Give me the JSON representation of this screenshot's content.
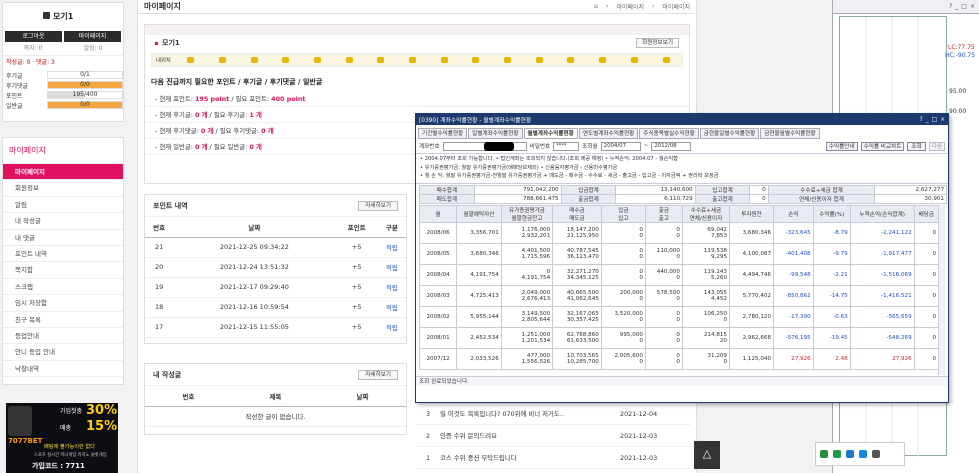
{
  "side": {
    "username": "모기1",
    "login_btn": "로그아웃",
    "mypage_btn": "마이페이지",
    "note_label": "쪽지: 0",
    "alarm_label": "알림: 0",
    "activity": "작성글: 0 · 댓글: 3",
    "stats": [
      {
        "k": "후기글",
        "v": "0/1",
        "fill": 0
      },
      {
        "k": "후기댓글",
        "v": "0/0",
        "fill": 1,
        "orange": true
      },
      {
        "k": "포인트",
        "v": "195/400",
        "fill": 0.49
      },
      {
        "k": "일반글",
        "v": "0/0",
        "fill": 1,
        "orange": true
      }
    ],
    "menu_title": "마이페이지",
    "menu": [
      "마이페이지",
      "회원정보",
      "알림",
      "내 작성글",
      "내 댓글",
      "포인트 내역",
      "쪽지함",
      "스크랩",
      "임시 저장함",
      "친구 목록",
      "등업안내",
      "안니 등업 안내",
      "낙찰내역"
    ],
    "ad_line1": "가입첫충",
    "ad_pct1": "30%",
    "ad_brand": "7077BET",
    "ad_line2": "매충",
    "ad_pct2": "15%",
    "ad_line3": "배팅에 불가능이란 없다",
    "ad_line4": "스포츠 실시간 미니게임 카지노 슬롯게임",
    "ad_code": "가입코드 : 7711"
  },
  "main": {
    "title": "마이페이지",
    "breadcrumb": [
      "마이페이지",
      "마이페이지"
    ],
    "user": "모기1",
    "info_btn": "회원정보보기",
    "level_label": "내위치",
    "next_title": "다음 진급까지 필요한 포인트 / 후기글 / 후기댓글 / 일반글",
    "req_lines": [
      {
        "a": "- 현재 포인트: ",
        "av": "195 point",
        "b": " / 필요 포인트: ",
        "bv": "400 point"
      },
      {
        "a": "- 현재 후기글: ",
        "av": "0 개",
        "b": " / 필요 후기글: ",
        "bv": "1 개"
      },
      {
        "a": "- 현재 후기댓글: ",
        "av": "0 개",
        "b": " / 필요 후기댓글: ",
        "bv": "0 개"
      },
      {
        "a": "- 현재 일반글: ",
        "av": "0 개",
        "b": " / 필요 일반글: ",
        "bv": "0 개"
      }
    ],
    "points_title": "포인트 내역",
    "more": "자세히보기",
    "points_headers": [
      "번호",
      "날짜",
      "포인트",
      "구분"
    ],
    "points": [
      {
        "n": "21",
        "d": "2021-12-25 09:34:22",
        "p": "+5",
        "t": "적립"
      },
      {
        "n": "20",
        "d": "2021-12-24 13:51:32",
        "p": "+5",
        "t": "적립"
      },
      {
        "n": "19",
        "d": "2021-12-17 09:29:40",
        "p": "+5",
        "t": "적립"
      },
      {
        "n": "18",
        "d": "2021-12-16 10:59:54",
        "p": "+5",
        "t": "적립"
      },
      {
        "n": "17",
        "d": "2021-12-15 11:55:05",
        "p": "+5",
        "t": "적립"
      }
    ],
    "posts_title": "내 작성글",
    "posts_headers": [
      "번호",
      "제목",
      "날짜"
    ],
    "posts_empty": "작성한 글이 없습니다.",
    "comments": [
      {
        "n": "3",
        "t": "릴 이것도 목록입니다? 070위에 비너 저거도..",
        "d": "2021-12-04"
      },
      {
        "n": "2",
        "t": "인증 수위 문의드려요",
        "d": "2021-12-03"
      },
      {
        "n": "1",
        "t": "코스 수위 중션 부탁드립니다",
        "d": "2021-12-03"
      }
    ]
  },
  "win": {
    "title": "[0390] 계좌수익률현황 - 월별계좌수익률현황",
    "tabs": [
      "기간별수익률현황",
      "일별계좌수익률현황",
      "월별계좌수익률현황",
      "연도별계좌수익률현황",
      "주식종목별실수익현황",
      "금현물일별수익률현황",
      "금현물월별수익률현황"
    ],
    "acct_label": "계좌번호",
    "pw_label": "비밀번호",
    "pw": "****",
    "period_label": "조회월",
    "from": "2004/07",
    "to": "2012/08",
    "b1": "수익률안내",
    "b2": "수익률 비교차트",
    "b3": "조회",
    "b4": "다음",
    "notes": [
      "• 2004.07부터 조회 가능합니다.   • 법인계좌는 조회되지 않습니다.(조회 제공 예정)   • 누적손익: 2004.07 - 월손익합",
      "• 유가증권평가금: 월말 유가증권평가금(매매당보제외) • 신용융자평가금 - 신용미수평가금",
      "• 월 손 익: 월말 유가증권평가금-전월말 유가증권평가금 + 매도금 - 매수금 - 수수료 - 세금 - 출고금 - 입고금 - 이자금액 + 권리락 보정금"
    ],
    "sum": [
      [
        "매수합계",
        "791,042,200",
        "입금합계",
        "13,140,600",
        "입고합계",
        "0",
        "수수료+세금 합계",
        "2,627,277"
      ],
      [
        "매도합계",
        "788,661,475",
        "출금합계",
        "6,110,729",
        "출고합계",
        "0",
        "연체/신용이자 합계",
        "30,901"
      ]
    ],
    "headers": [
      "월",
      "월말예탁자산",
      "유가증권평가금|월말현금잔고",
      "매수금|매도금",
      "입금|입고",
      "출금|출고",
      "수수료+세금|연체/신용이자",
      "투자원잔",
      "손익",
      "수익률(%)",
      "누적손익(손익합계)",
      "배당금"
    ],
    "rows": [
      [
        "2008/06",
        "3,356,701",
        "1,176,000|2,932,201",
        "18,147,200|21,125,950",
        "0|0",
        "0|0",
        "69,042|7,853",
        "3,680,346",
        "-323,645",
        "-8.79",
        "-2,241,122",
        "0"
      ],
      [
        "2008/05",
        "3,680,346",
        "4,401,500|1,715,596",
        "40,787,545|36,113,470",
        "0|0",
        "110,000|0",
        "119,538|9,295",
        "4,100,087",
        "-401,408",
        "-9.79",
        "-1,917,477",
        "0"
      ],
      [
        "2008/04",
        "4,191,754",
        "0|4,191,754",
        "32,271,270|34,345,125",
        "0|0",
        "440,000|0",
        "119,143|5,260",
        "4,494,746",
        "-99,548",
        "-2.21",
        "-1,516,069",
        "0"
      ],
      [
        "2008/03",
        "4,725,413",
        "2,049,000|2,676,413",
        "40,665,500|41,062,645",
        "200,000|0",
        "578,500|0",
        "143,055|4,452",
        "5,770,402",
        "-850,862",
        "-14.75",
        "-1,416,521",
        "0"
      ],
      [
        "2008/02",
        "5,955,144",
        "3,149,500|2,805,644",
        "32,167,065|30,357,425",
        "3,520,000|0",
        "0|0",
        "106,250|0",
        "2,780,120",
        "-17,390",
        "-0.63",
        "-565,659",
        "0"
      ],
      [
        "2008/01",
        "2,452,534",
        "1,251,000|1,201,534",
        "62,768,860|61,633,500",
        "995,000|0",
        "0|0",
        "214,815|20",
        "2,962,668",
        "-576,195",
        "-19.45",
        "-548,269",
        "0"
      ],
      [
        "2007/12",
        "2,033,526",
        "477,000|1,556,526",
        "10,703,565|10,285,700",
        "2,005,600|0",
        "0|0",
        "31,209|0",
        "1,125,040",
        "27,926",
        "2.48",
        "27,926",
        "0"
      ]
    ],
    "status": "조회 완료되었습니다."
  },
  "right": {
    "hc1": "LC:77.75",
    "hc2": "HC:-90.75",
    "p1": "95.00",
    "p2": "90.00"
  }
}
